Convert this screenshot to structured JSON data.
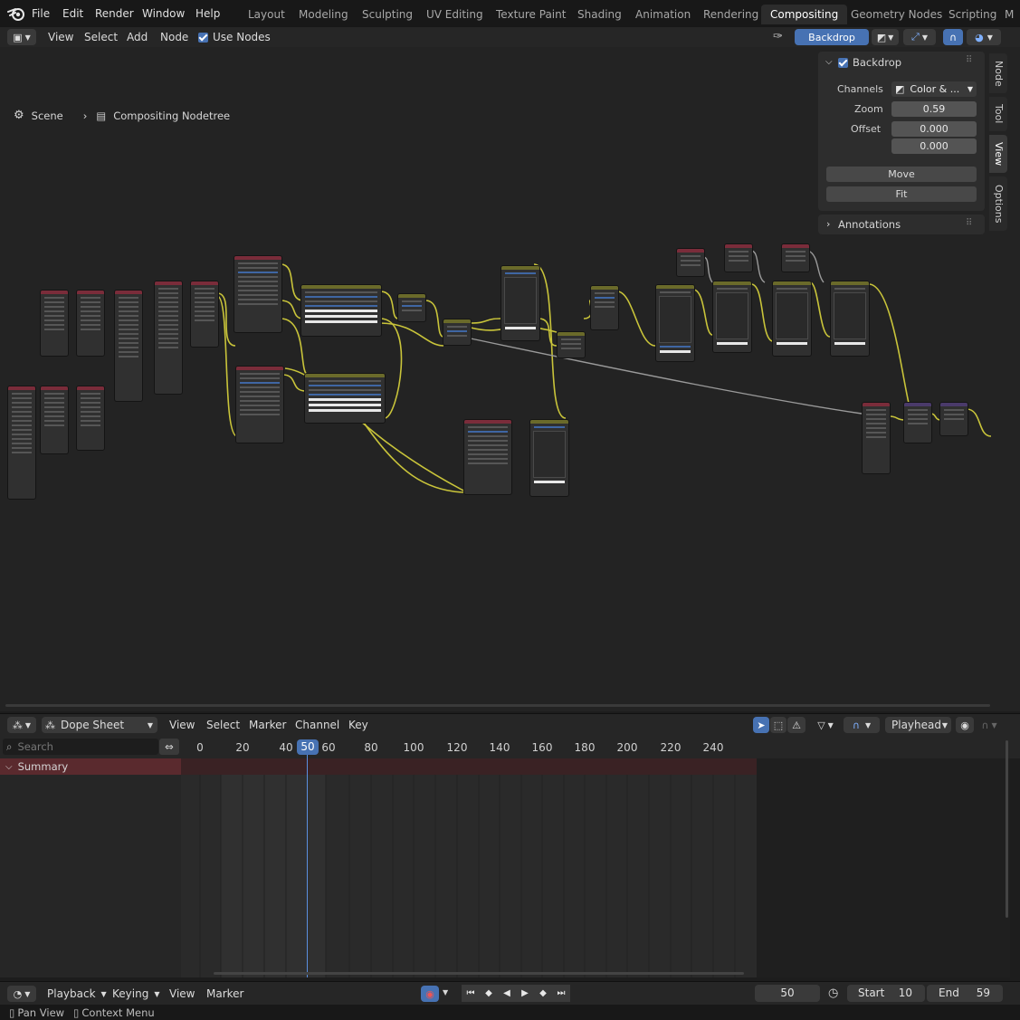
{
  "menubar": {
    "items": [
      "File",
      "Edit",
      "Render",
      "Window",
      "Help"
    ],
    "workspaces": [
      "Layout",
      "Modeling",
      "Sculpting",
      "UV Editing",
      "Texture Paint",
      "Shading",
      "Animation",
      "Rendering",
      "Compositing",
      "Geometry Nodes",
      "Scripting",
      "M"
    ],
    "active_workspace": "Compositing"
  },
  "node_header": {
    "menus": [
      "View",
      "Select",
      "Add",
      "Node"
    ],
    "use_nodes_label": "Use Nodes",
    "backdrop_button": "Backdrop"
  },
  "breadcrumb": {
    "scene": "Scene",
    "nodetree": "Compositing Nodetree"
  },
  "npanel": {
    "backdrop_title": "Backdrop",
    "channels_label": "Channels",
    "channels_value": "Color & ...",
    "zoom_label": "Zoom",
    "zoom_value": "0.59",
    "offset_label": "Offset",
    "offset_x": "0.000",
    "offset_y": "0.000",
    "move_button": "Move",
    "fit_button": "Fit",
    "annotations_title": "Annotations",
    "tabs": [
      "Node",
      "Tool",
      "View",
      "Options"
    ],
    "active_tab": "View"
  },
  "dopesheet": {
    "mode": "Dope Sheet",
    "menus": [
      "View",
      "Select",
      "Marker",
      "Channel",
      "Key"
    ],
    "playhead_label": "Playhead",
    "search_placeholder": "Search",
    "summary_label": "Summary",
    "current_frame": "50",
    "ruler_ticks": [
      "0",
      "20",
      "40",
      "60",
      "80",
      "100",
      "120",
      "140",
      "160",
      "180",
      "200",
      "220",
      "240"
    ]
  },
  "timeline": {
    "menus": [
      "Playback",
      "Keying",
      "View",
      "Marker"
    ],
    "current_frame": "50",
    "start_label": "Start",
    "start_value": "10",
    "end_label": "End",
    "end_value": "59"
  },
  "statusbar": {
    "pan_view": "Pan View",
    "context_menu": "Context Menu"
  },
  "colors": {
    "accent": "#4772b3",
    "link_yellow": "#c9c43a",
    "link_gray": "#9a9a9a",
    "summary_red": "#5a2a2e"
  }
}
